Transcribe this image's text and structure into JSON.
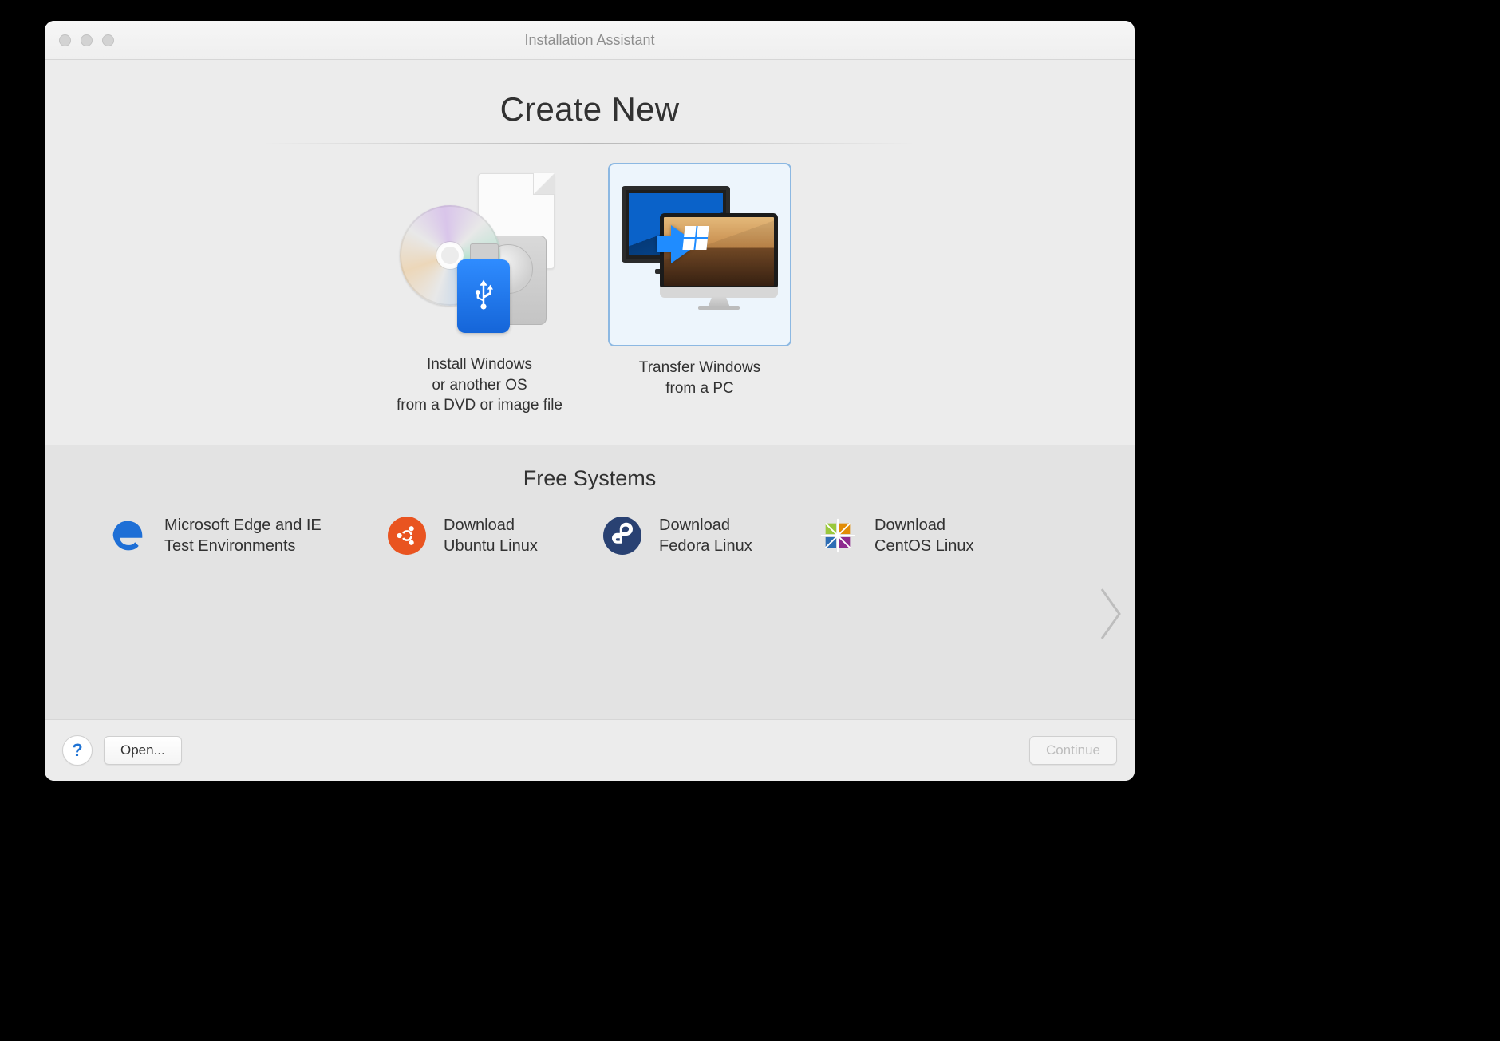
{
  "window": {
    "title": "Installation Assistant"
  },
  "create": {
    "heading": "Create New",
    "options": [
      {
        "line1": "Install Windows",
        "line2": "or another OS",
        "line3": "from a DVD or image file",
        "selected": false
      },
      {
        "line1": "Transfer Windows",
        "line2": "from a PC",
        "selected": true
      }
    ]
  },
  "free": {
    "heading": "Free Systems",
    "items": [
      {
        "line1": "Microsoft Edge and IE",
        "line2": "Test Environments",
        "icon": "edge"
      },
      {
        "line1": "Download",
        "line2": "Ubuntu Linux",
        "icon": "ubuntu"
      },
      {
        "line1": "Download",
        "line2": "Fedora Linux",
        "icon": "fedora"
      },
      {
        "line1": "Download",
        "line2": "CentOS Linux",
        "icon": "centos"
      }
    ]
  },
  "bottom": {
    "help": "?",
    "open": "Open...",
    "continue": "Continue"
  }
}
